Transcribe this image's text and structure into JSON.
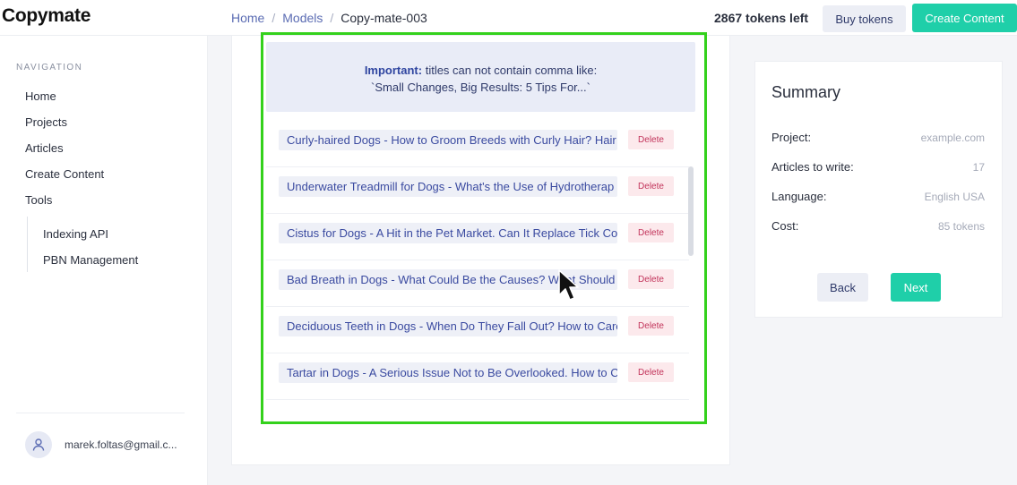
{
  "header": {
    "logo": "Copymate",
    "breadcrumb": [
      "Home",
      "Models",
      "Copy-mate-003"
    ],
    "tokens_left": "2867 tokens left",
    "buy_tokens": "Buy tokens",
    "create_content": "Create Content"
  },
  "sidebar": {
    "heading": "NAVIGATION",
    "items": [
      "Home",
      "Projects",
      "Articles",
      "Create Content",
      "Tools"
    ],
    "sub_items": [
      "Indexing API",
      "PBN Management"
    ],
    "user_email": "marek.foltas@gmail.c..."
  },
  "notice": {
    "bold": "Important:",
    "line1": " titles can not contain comma like:",
    "line2": "`Small Changes, Big Results: 5 Tips For...`"
  },
  "titles": [
    "Curly-haired Dogs - How to Groom Breeds with Curly Hair? Hair",
    "Underwater Treadmill for Dogs - What's the Use of Hydrotherap",
    "Cistus for Dogs - A Hit in the Pet Market. Can It Replace Tick Co",
    "Bad Breath in Dogs - What Could Be the Causes? What Should",
    "Deciduous Teeth in Dogs - When Do They Fall Out? How to Care",
    "Tartar in Dogs - A Serious Issue Not to Be Overlooked. How to C"
  ],
  "delete_label": "Delete",
  "summary": {
    "title": "Summary",
    "rows": [
      {
        "label": "Project:",
        "value": "example.com"
      },
      {
        "label": "Articles to write:",
        "value": "17"
      },
      {
        "label": "Language:",
        "value": "English USA"
      },
      {
        "label": "Cost:",
        "value": "85 tokens"
      }
    ],
    "back": "Back",
    "next": "Next"
  },
  "colors": {
    "accent": "#1fcfa9",
    "highlight": "#34d11c",
    "delete": "#c2335a"
  }
}
